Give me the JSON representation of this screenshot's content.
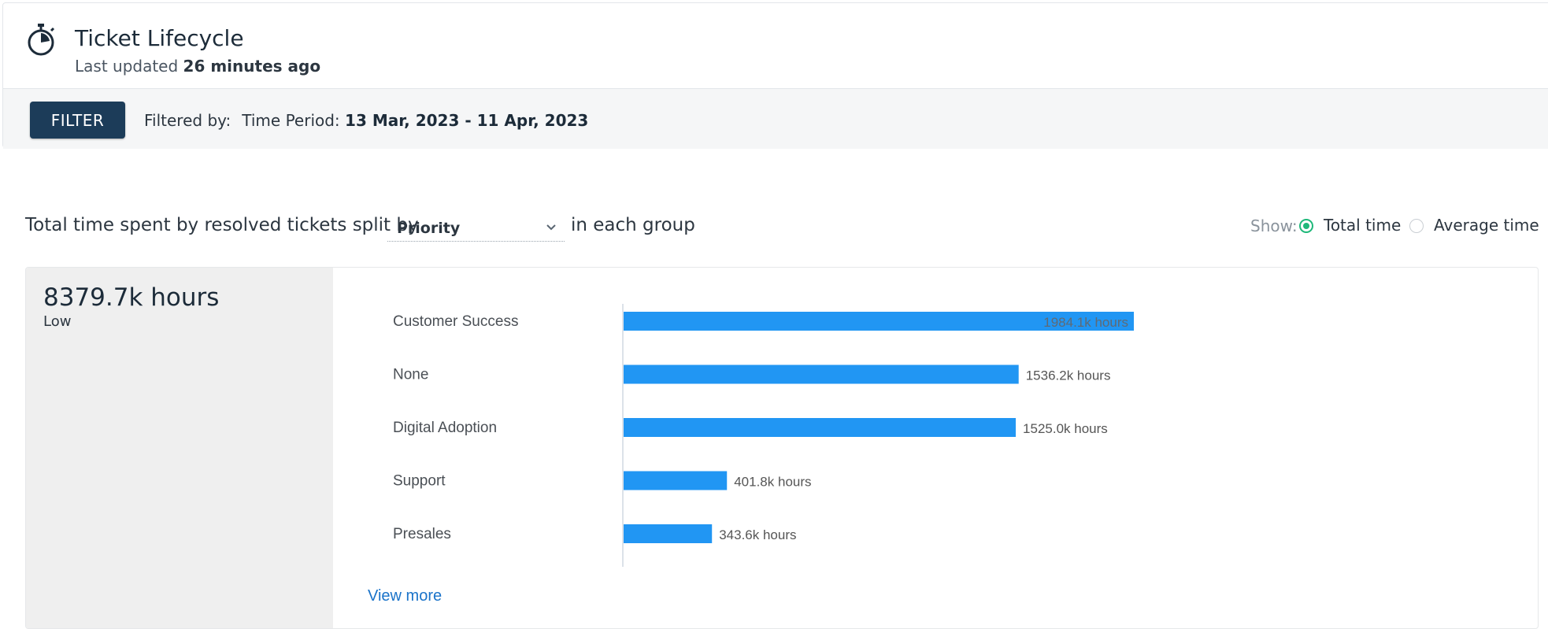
{
  "header": {
    "icon": "stopwatch-icon",
    "title": "Ticket Lifecycle",
    "updated_prefix": "Last updated",
    "updated_value": "26 minutes ago"
  },
  "filter_bar": {
    "button_label": "FILTER",
    "filtered_by_label": "Filtered by:",
    "time_period_label": "Time Period:",
    "time_period_value": "13 Mar, 2023 - 11 Apr, 2023"
  },
  "toolbar": {
    "prefix": "Total time spent by resolved tickets split by",
    "split_selected": "Priority",
    "suffix": "in each group",
    "show_label": "Show:",
    "options": [
      {
        "label": "Total time",
        "selected": true
      },
      {
        "label": "Average time",
        "selected": false
      }
    ]
  },
  "summary": {
    "total": "8379.7k hours",
    "group": "Low"
  },
  "chart_data": {
    "type": "bar",
    "orientation": "horizontal",
    "categories": [
      "Customer Success",
      "None",
      "Digital Adoption",
      "Support",
      "Presales"
    ],
    "values": [
      1984.1,
      1536.2,
      1525.0,
      401.8,
      343.6
    ],
    "labels": [
      "1984.1k hours",
      "1536.2k hours",
      "1525.0k hours",
      "401.8k hours",
      "343.6k hours"
    ],
    "unit": "k hours",
    "bar_color": "#2196f3"
  },
  "view_more_label": "View more"
}
